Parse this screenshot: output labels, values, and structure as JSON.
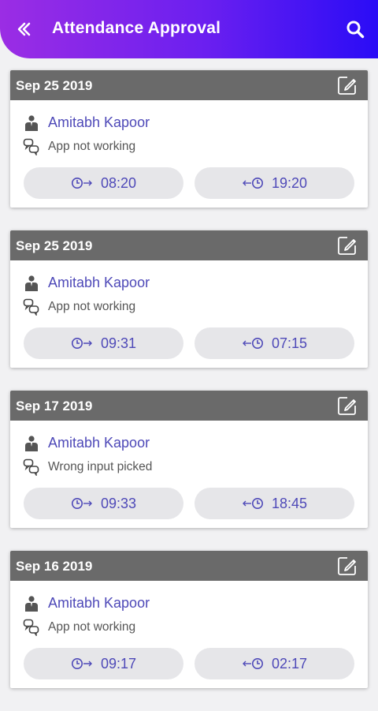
{
  "header": {
    "title": "Attendance Approval",
    "bg_start": "#9b2de4",
    "bg_end": "#2a0cf6"
  },
  "records": [
    {
      "date": "Sep 25 2019",
      "name": "Amitabh Kapoor",
      "reason": "App not working",
      "in_time": "08:20",
      "out_time": "19:20"
    },
    {
      "date": "Sep 25 2019",
      "name": "Amitabh Kapoor",
      "reason": "App not working",
      "in_time": "09:31",
      "out_time": "07:15"
    },
    {
      "date": "Sep 17 2019",
      "name": "Amitabh Kapoor",
      "reason": "Wrong input picked",
      "in_time": "09:33",
      "out_time": "18:45"
    },
    {
      "date": "Sep 16 2019",
      "name": "Amitabh Kapoor",
      "reason": "App not working",
      "in_time": "09:17",
      "out_time": "02:17"
    }
  ],
  "icons": {
    "back": "chevron-double-left-icon",
    "search": "search-icon",
    "edit": "edit-icon",
    "person": "person-icon",
    "reason": "chat-bubbles-icon",
    "check_in": "clock-in-icon",
    "check_out": "clock-out-icon"
  },
  "colors": {
    "accent": "#4e49b8",
    "card_header": "#6a6a6a",
    "pill_bg": "#e6e6e9"
  }
}
